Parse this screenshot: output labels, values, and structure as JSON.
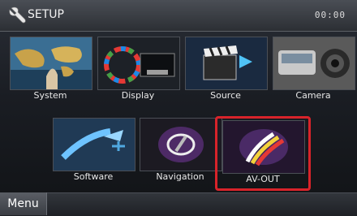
{
  "header": {
    "title": "SETUP",
    "clock": "00:00"
  },
  "tiles": [
    {
      "label": "System"
    },
    {
      "label": "Display"
    },
    {
      "label": "Source"
    },
    {
      "label": "Camera"
    },
    {
      "label": "Software"
    },
    {
      "label": "Navigation"
    },
    {
      "label": "AV-OUT"
    }
  ],
  "footer": {
    "menu_label": "Menu"
  },
  "colors": {
    "highlight": "#d8232a"
  }
}
